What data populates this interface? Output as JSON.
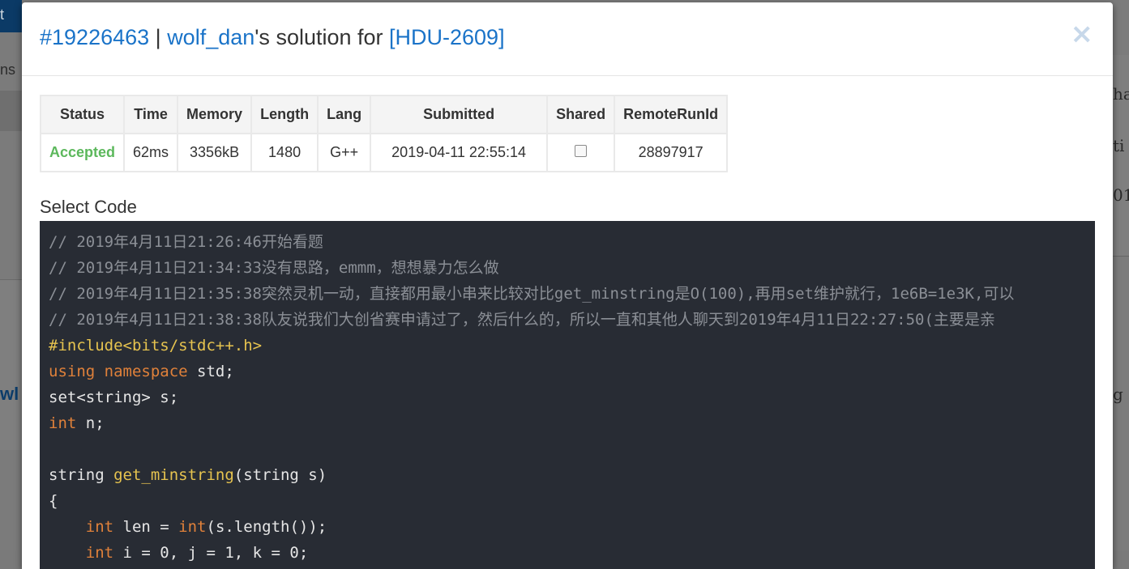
{
  "background": {
    "left_top_text": "t",
    "left_mid_text": "ns",
    "left_bold_text": "wl",
    "right_texts": [
      "ha",
      "ti",
      "01",
      "g"
    ]
  },
  "modal": {
    "title": {
      "run_id": "#19226463",
      "separator": " | ",
      "user": "wolf_dan",
      "middle": "'s solution for ",
      "problem": "[HDU-2609]"
    },
    "close_label": "×"
  },
  "table": {
    "headers": [
      "Status",
      "Time",
      "Memory",
      "Length",
      "Lang",
      "Submitted",
      "Shared",
      "RemoteRunId"
    ],
    "row": {
      "status": "Accepted",
      "time": "62ms",
      "memory": "3356kB",
      "length": "1480",
      "lang": "G++",
      "submitted": "2019-04-11 22:55:14",
      "shared": false,
      "remote_run_id": "28897917"
    },
    "colors": {
      "accepted": "#5cb85c"
    }
  },
  "code_section": {
    "label": "Select Code",
    "lines": [
      [
        {
          "t": "// 2019年4月11日21:26:46开始看题",
          "c": "cm"
        }
      ],
      [
        {
          "t": "// 2019年4月11日21:34:33没有思路，emmm，想想暴力怎么做",
          "c": "cm"
        }
      ],
      [
        {
          "t": "// 2019年4月11日21:35:38突然灵机一动，直接都用最小串来比较对比get_minstring是O(100),再用set维护就行，1e6B=1e3K,可以",
          "c": "cm"
        }
      ],
      [
        {
          "t": "// 2019年4月11日21:38:38队友说我们大创省赛申请过了，然后什么的，所以一直和其他人聊天到2019年4月11日22:27:50(主要是亲",
          "c": "cm"
        }
      ],
      [
        {
          "t": "#include<bits/stdc++.h>",
          "c": "pp"
        }
      ],
      [
        {
          "t": "using",
          "c": "kw"
        },
        {
          "t": " "
        },
        {
          "t": "namespace",
          "c": "kw"
        },
        {
          "t": " std;"
        }
      ],
      [
        {
          "t": "set<string> s;"
        }
      ],
      [
        {
          "t": "int",
          "c": "kw"
        },
        {
          "t": " n;"
        }
      ],
      [
        {
          "t": ""
        }
      ],
      [
        {
          "t": "string "
        },
        {
          "t": "get_minstring",
          "c": "fn"
        },
        {
          "t": "(string s)"
        }
      ],
      [
        {
          "t": "{"
        }
      ],
      [
        {
          "t": "    "
        },
        {
          "t": "int",
          "c": "kw"
        },
        {
          "t": " len = "
        },
        {
          "t": "int",
          "c": "kw"
        },
        {
          "t": "(s.length());"
        }
      ],
      [
        {
          "t": "    "
        },
        {
          "t": "int",
          "c": "kw"
        },
        {
          "t": " i = 0, j = 1, k = 0;"
        }
      ]
    ]
  }
}
